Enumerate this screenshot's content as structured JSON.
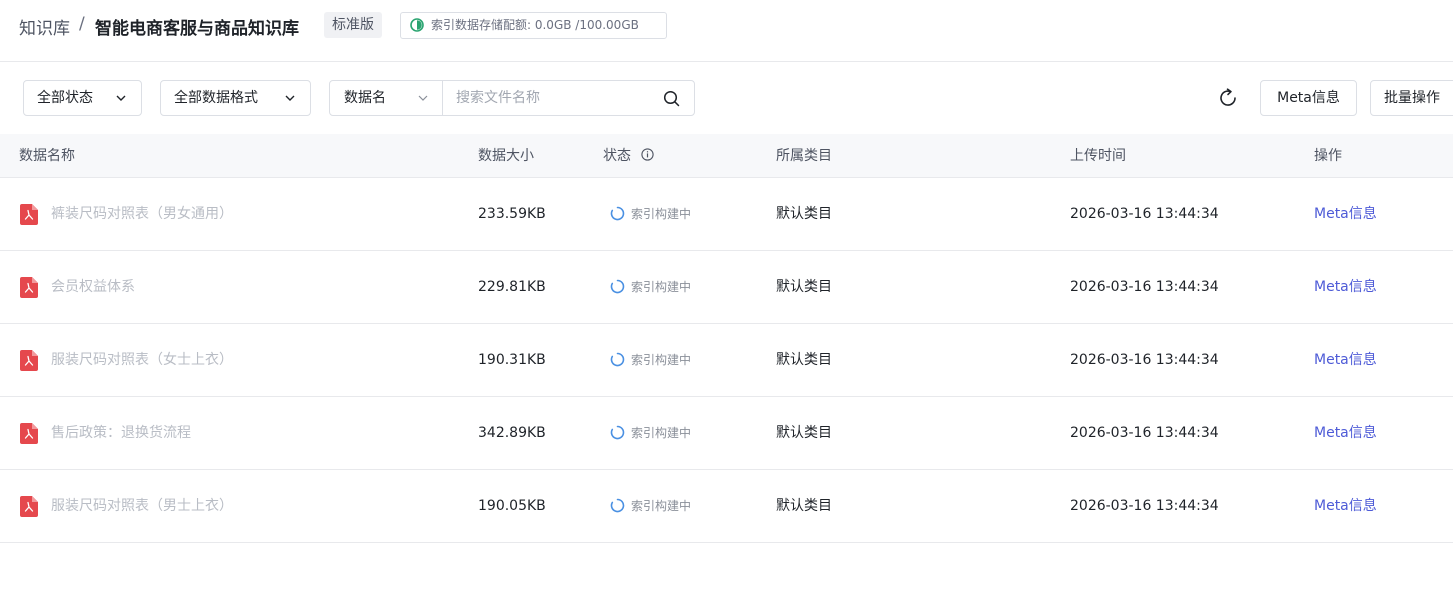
{
  "header": {
    "breadcrumb_root": "知识库",
    "breadcrumb_sep": "/",
    "title": "智能电商客服与商品知识库",
    "edition": "标准版",
    "quota_text": "索引数据存储配额: 0.0GB /100.00GB"
  },
  "toolbar": {
    "status_filter": "全部状态",
    "format_filter": "全部数据格式",
    "search_field": "数据名",
    "search_placeholder": "搜索文件名称",
    "search_value": "",
    "meta_button": "Meta信息",
    "batch_button": "批量操作"
  },
  "table": {
    "columns": {
      "name": "数据名称",
      "size": "数据大小",
      "status": "状态",
      "category": "所属类目",
      "upload_time": "上传时间",
      "actions": "操作"
    },
    "rows": [
      {
        "name": "裤装尺码对照表（男女通用）",
        "size": "233.59KB",
        "status": "索引构建中",
        "category": "默认类目",
        "upload_time": "2026-03-16 13:44:34",
        "action": "Meta信息"
      },
      {
        "name": "会员权益体系",
        "size": "229.81KB",
        "status": "索引构建中",
        "category": "默认类目",
        "upload_time": "2026-03-16 13:44:34",
        "action": "Meta信息"
      },
      {
        "name": "服装尺码对照表（女士上衣）",
        "size": "190.31KB",
        "status": "索引构建中",
        "category": "默认类目",
        "upload_time": "2026-03-16 13:44:34",
        "action": "Meta信息"
      },
      {
        "name": "售后政策：退换货流程",
        "size": "342.89KB",
        "status": "索引构建中",
        "category": "默认类目",
        "upload_time": "2026-03-16 13:44:34",
        "action": "Meta信息"
      },
      {
        "name": "服装尺码对照表（男士上衣）",
        "size": "190.05KB",
        "status": "索引构建中",
        "category": "默认类目",
        "upload_time": "2026-03-16 13:44:34",
        "action": "Meta信息"
      }
    ]
  },
  "colors": {
    "accent": "#4e5bd7",
    "pdf_icon": "#e5484d",
    "spinner": "#4a90e2",
    "quota_icon": "#2ba471"
  },
  "icons": {
    "file": "pdf-file-icon",
    "status": "loading-spinner-icon",
    "refresh": "refresh-icon",
    "search": "search-icon",
    "dropdown": "chevron-down-icon",
    "info": "info-circle-icon",
    "quota": "pie-chart-icon"
  }
}
